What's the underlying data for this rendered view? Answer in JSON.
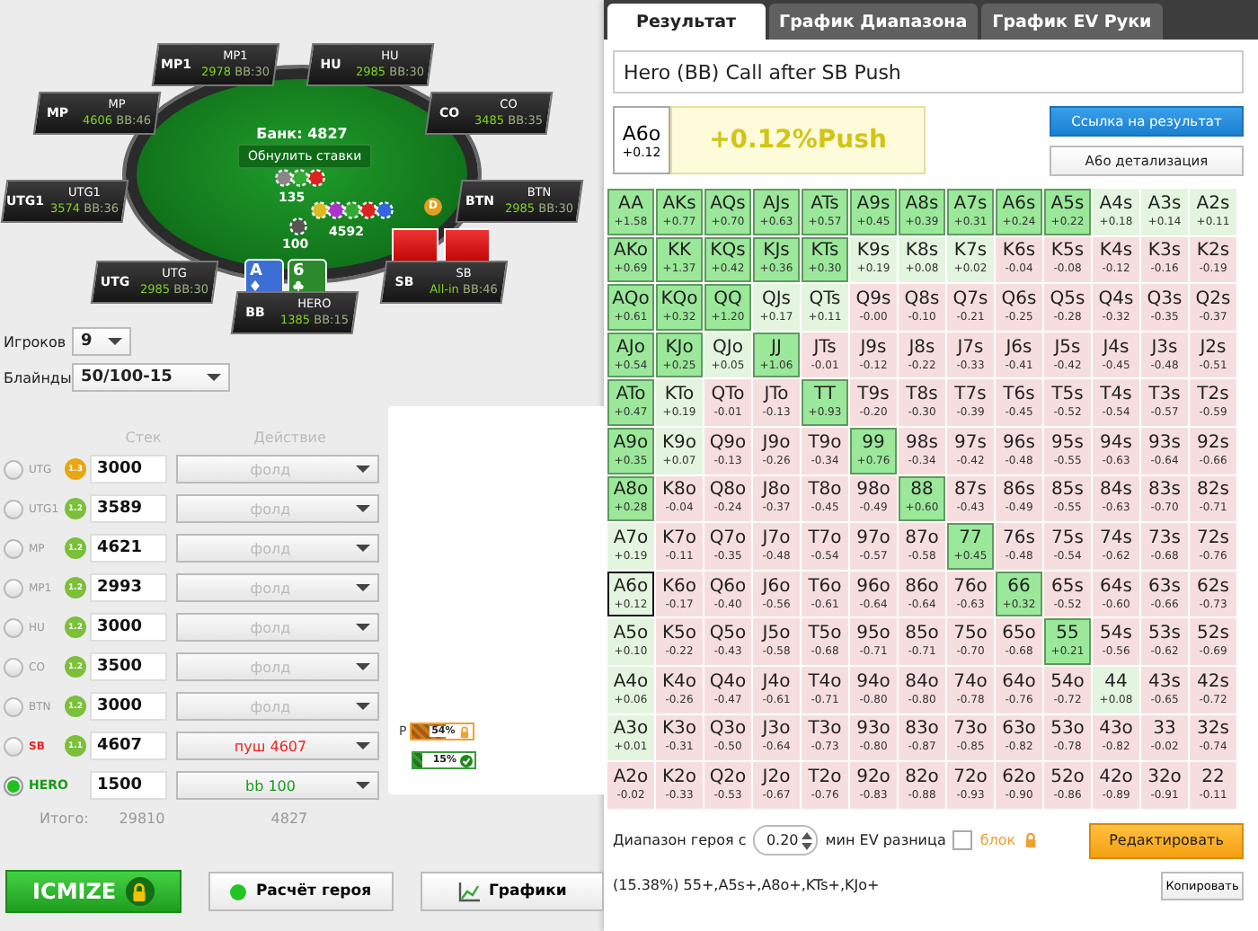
{
  "table": {
    "pot": "Банк: 4827",
    "reset_button": "Обнулить ставки",
    "dealer_button": "D",
    "seats": [
      {
        "position": "MP1",
        "name": "MP1",
        "stack": "2978",
        "bb": "BB:30"
      },
      {
        "position": "HU",
        "name": "HU",
        "stack": "2985",
        "bb": "BB:30"
      },
      {
        "position": "MP",
        "name": "MP",
        "stack": "4606",
        "bb": "BB:46"
      },
      {
        "position": "CO",
        "name": "CO",
        "stack": "3485",
        "bb": "BB:35"
      },
      {
        "position": "UTG1",
        "name": "UTG1",
        "stack": "3574",
        "bb": "BB:36"
      },
      {
        "position": "BTN",
        "name": "BTN",
        "stack": "2985",
        "bb": "BB:30"
      },
      {
        "position": "UTG",
        "name": "UTG",
        "stack": "2985",
        "bb": "BB:30"
      },
      {
        "position": "BB",
        "name": "HERO",
        "stack": "1385",
        "bb": "BB:15"
      },
      {
        "position": "SB",
        "name": "SB",
        "stack": "All-in",
        "bb": "BB:46"
      }
    ],
    "bets": [
      {
        "amount": "135"
      },
      {
        "amount": "4592"
      },
      {
        "amount": "100"
      }
    ],
    "hero_cards": [
      {
        "rank": "A",
        "kind": "diamond"
      },
      {
        "rank": "6",
        "kind": "club"
      }
    ]
  },
  "settings": {
    "players_label": "Игроков",
    "players": "9",
    "blinds_label": "Блайнды",
    "blinds": "50/100-15",
    "stack_header": "Стек",
    "action_header": "Действие"
  },
  "players": [
    {
      "position": "UTG",
      "badge": "1.3",
      "color": "#e8a614",
      "stack": "3000",
      "action": "фолд",
      "kind": "fold",
      "selected": false
    },
    {
      "position": "UTG1",
      "badge": "1.2",
      "color": "#7cbf3a",
      "stack": "3589",
      "action": "фолд",
      "kind": "fold",
      "selected": false
    },
    {
      "position": "MP",
      "badge": "1.2",
      "color": "#7cbf3a",
      "stack": "4621",
      "action": "фолд",
      "kind": "fold",
      "selected": false
    },
    {
      "position": "MP1",
      "badge": "1.2",
      "color": "#7cbf3a",
      "stack": "2993",
      "action": "фолд",
      "kind": "fold",
      "selected": false
    },
    {
      "position": "HU",
      "badge": "1.2",
      "color": "#7cbf3a",
      "stack": "3000",
      "action": "фолд",
      "kind": "fold",
      "selected": false
    },
    {
      "position": "CO",
      "badge": "1.2",
      "color": "#7cbf3a",
      "stack": "3500",
      "action": "фолд",
      "kind": "fold",
      "selected": false
    },
    {
      "position": "BTN",
      "badge": "1.2",
      "color": "#7cbf3a",
      "stack": "3000",
      "action": "фолд",
      "kind": "fold",
      "selected": false
    },
    {
      "position": "SB",
      "badge": "1.1",
      "color": "#7cbf3a",
      "stack": "4607",
      "action": "пуш 4607",
      "kind": "push",
      "selected": false
    },
    {
      "position": "HERO",
      "stack": "1500",
      "action": "bb 100",
      "kind": "call",
      "selected": true
    }
  ],
  "totals": {
    "label": "Итого:",
    "stack": "29810",
    "pot": "4827"
  },
  "ranges": [
    {
      "label": "P",
      "kind": "locked",
      "level": 0.54,
      "reading": "54%"
    },
    {
      "kind": "checked",
      "level": 0.15,
      "reading": "15%"
    }
  ],
  "buttons": [
    {
      "label": "ICMIZE",
      "kind": "primary"
    },
    {
      "label": "Расчёт героя",
      "kind": "dot"
    },
    {
      "label": "Графики",
      "kind": "chart"
    }
  ],
  "result": {
    "tabs": [
      {
        "label": "Результат",
        "selected": true
      },
      {
        "label": "График Диапазона",
        "selected": false
      },
      {
        "label": "График EV Руки",
        "selected": false
      }
    ],
    "title": "Hero (BB) Call after SB Push",
    "hand": "A6o",
    "hand_ev": "+0.12",
    "verdict": "+0.12%Push",
    "link_button": "Ссылка на результат",
    "detail_button": "A6o детализация",
    "grid": [
      [
        {
          "hand": "AA",
          "ev": "+1.58",
          "in_range": true,
          "current": false
        },
        {
          "hand": "AKs",
          "ev": "+0.77",
          "in_range": true,
          "current": false
        },
        {
          "hand": "AQs",
          "ev": "+0.70",
          "in_range": true,
          "current": false
        },
        {
          "hand": "AJs",
          "ev": "+0.63",
          "in_range": true,
          "current": false
        },
        {
          "hand": "ATs",
          "ev": "+0.57",
          "in_range": true,
          "current": false
        },
        {
          "hand": "A9s",
          "ev": "+0.45",
          "in_range": true,
          "current": false
        },
        {
          "hand": "A8s",
          "ev": "+0.39",
          "in_range": true,
          "current": false
        },
        {
          "hand": "A7s",
          "ev": "+0.31",
          "in_range": true,
          "current": false
        },
        {
          "hand": "A6s",
          "ev": "+0.24",
          "in_range": true,
          "current": false
        },
        {
          "hand": "A5s",
          "ev": "+0.22",
          "in_range": true,
          "current": false
        },
        {
          "hand": "A4s",
          "ev": "+0.18",
          "in_range": false,
          "current": false
        },
        {
          "hand": "A3s",
          "ev": "+0.14",
          "in_range": false,
          "current": false
        },
        {
          "hand": "A2s",
          "ev": "+0.11",
          "in_range": false,
          "current": false
        }
      ],
      [
        {
          "hand": "AKo",
          "ev": "+0.69",
          "in_range": true,
          "current": false
        },
        {
          "hand": "KK",
          "ev": "+1.37",
          "in_range": true,
          "current": false
        },
        {
          "hand": "KQs",
          "ev": "+0.42",
          "in_range": true,
          "current": false
        },
        {
          "hand": "KJs",
          "ev": "+0.36",
          "in_range": true,
          "current": false
        },
        {
          "hand": "KTs",
          "ev": "+0.30",
          "in_range": true,
          "current": false
        },
        {
          "hand": "K9s",
          "ev": "+0.19",
          "in_range": false,
          "current": false
        },
        {
          "hand": "K8s",
          "ev": "+0.08",
          "in_range": false,
          "current": false
        },
        {
          "hand": "K7s",
          "ev": "+0.02",
          "in_range": false,
          "current": false
        },
        {
          "hand": "K6s",
          "ev": "-0.04",
          "in_range": false,
          "current": false
        },
        {
          "hand": "K5s",
          "ev": "-0.08",
          "in_range": false,
          "current": false
        },
        {
          "hand": "K4s",
          "ev": "-0.12",
          "in_range": false,
          "current": false
        },
        {
          "hand": "K3s",
          "ev": "-0.16",
          "in_range": false,
          "current": false
        },
        {
          "hand": "K2s",
          "ev": "-0.19",
          "in_range": false,
          "current": false
        }
      ],
      [
        {
          "hand": "AQo",
          "ev": "+0.61",
          "in_range": true,
          "current": false
        },
        {
          "hand": "KQo",
          "ev": "+0.32",
          "in_range": true,
          "current": false
        },
        {
          "hand": "QQ",
          "ev": "+1.20",
          "in_range": true,
          "current": false
        },
        {
          "hand": "QJs",
          "ev": "+0.17",
          "in_range": false,
          "current": false
        },
        {
          "hand": "QTs",
          "ev": "+0.11",
          "in_range": false,
          "current": false
        },
        {
          "hand": "Q9s",
          "ev": "-0.00",
          "in_range": false,
          "current": false
        },
        {
          "hand": "Q8s",
          "ev": "-0.10",
          "in_range": false,
          "current": false
        },
        {
          "hand": "Q7s",
          "ev": "-0.21",
          "in_range": false,
          "current": false
        },
        {
          "hand": "Q6s",
          "ev": "-0.25",
          "in_range": false,
          "current": false
        },
        {
          "hand": "Q5s",
          "ev": "-0.28",
          "in_range": false,
          "current": false
        },
        {
          "hand": "Q4s",
          "ev": "-0.32",
          "in_range": false,
          "current": false
        },
        {
          "hand": "Q3s",
          "ev": "-0.35",
          "in_range": false,
          "current": false
        },
        {
          "hand": "Q2s",
          "ev": "-0.37",
          "in_range": false,
          "current": false
        }
      ],
      [
        {
          "hand": "AJo",
          "ev": "+0.54",
          "in_range": true,
          "current": false
        },
        {
          "hand": "KJo",
          "ev": "+0.25",
          "in_range": true,
          "current": false
        },
        {
          "hand": "QJo",
          "ev": "+0.05",
          "in_range": false,
          "current": false
        },
        {
          "hand": "JJ",
          "ev": "+1.06",
          "in_range": true,
          "current": false
        },
        {
          "hand": "JTs",
          "ev": "-0.01",
          "in_range": false,
          "current": false
        },
        {
          "hand": "J9s",
          "ev": "-0.12",
          "in_range": false,
          "current": false
        },
        {
          "hand": "J8s",
          "ev": "-0.22",
          "in_range": false,
          "current": false
        },
        {
          "hand": "J7s",
          "ev": "-0.33",
          "in_range": false,
          "current": false
        },
        {
          "hand": "J6s",
          "ev": "-0.41",
          "in_range": false,
          "current": false
        },
        {
          "hand": "J5s",
          "ev": "-0.42",
          "in_range": false,
          "current": false
        },
        {
          "hand": "J4s",
          "ev": "-0.45",
          "in_range": false,
          "current": false
        },
        {
          "hand": "J3s",
          "ev": "-0.48",
          "in_range": false,
          "current": false
        },
        {
          "hand": "J2s",
          "ev": "-0.51",
          "in_range": false,
          "current": false
        }
      ],
      [
        {
          "hand": "ATo",
          "ev": "+0.47",
          "in_range": true,
          "current": false
        },
        {
          "hand": "KTo",
          "ev": "+0.19",
          "in_range": false,
          "current": false
        },
        {
          "hand": "QTo",
          "ev": "-0.01",
          "in_range": false,
          "current": false
        },
        {
          "hand": "JTo",
          "ev": "-0.13",
          "in_range": false,
          "current": false
        },
        {
          "hand": "TT",
          "ev": "+0.93",
          "in_range": true,
          "current": false
        },
        {
          "hand": "T9s",
          "ev": "-0.20",
          "in_range": false,
          "current": false
        },
        {
          "hand": "T8s",
          "ev": "-0.30",
          "in_range": false,
          "current": false
        },
        {
          "hand": "T7s",
          "ev": "-0.39",
          "in_range": false,
          "current": false
        },
        {
          "hand": "T6s",
          "ev": "-0.45",
          "in_range": false,
          "current": false
        },
        {
          "hand": "T5s",
          "ev": "-0.52",
          "in_range": false,
          "current": false
        },
        {
          "hand": "T4s",
          "ev": "-0.54",
          "in_range": false,
          "current": false
        },
        {
          "hand": "T3s",
          "ev": "-0.57",
          "in_range": false,
          "current": false
        },
        {
          "hand": "T2s",
          "ev": "-0.59",
          "in_range": false,
          "current": false
        }
      ],
      [
        {
          "hand": "A9o",
          "ev": "+0.35",
          "in_range": true,
          "current": false
        },
        {
          "hand": "K9o",
          "ev": "+0.07",
          "in_range": false,
          "current": false
        },
        {
          "hand": "Q9o",
          "ev": "-0.13",
          "in_range": false,
          "current": false
        },
        {
          "hand": "J9o",
          "ev": "-0.26",
          "in_range": false,
          "current": false
        },
        {
          "hand": "T9o",
          "ev": "-0.34",
          "in_range": false,
          "current": false
        },
        {
          "hand": "99",
          "ev": "+0.76",
          "in_range": true,
          "current": false
        },
        {
          "hand": "98s",
          "ev": "-0.34",
          "in_range": false,
          "current": false
        },
        {
          "hand": "97s",
          "ev": "-0.42",
          "in_range": false,
          "current": false
        },
        {
          "hand": "96s",
          "ev": "-0.48",
          "in_range": false,
          "current": false
        },
        {
          "hand": "95s",
          "ev": "-0.55",
          "in_range": false,
          "current": false
        },
        {
          "hand": "94s",
          "ev": "-0.63",
          "in_range": false,
          "current": false
        },
        {
          "hand": "93s",
          "ev": "-0.64",
          "in_range": false,
          "current": false
        },
        {
          "hand": "92s",
          "ev": "-0.66",
          "in_range": false,
          "current": false
        }
      ],
      [
        {
          "hand": "A8o",
          "ev": "+0.28",
          "in_range": true,
          "current": false
        },
        {
          "hand": "K8o",
          "ev": "-0.04",
          "in_range": false,
          "current": false
        },
        {
          "hand": "Q8o",
          "ev": "-0.24",
          "in_range": false,
          "current": false
        },
        {
          "hand": "J8o",
          "ev": "-0.37",
          "in_range": false,
          "current": false
        },
        {
          "hand": "T8o",
          "ev": "-0.45",
          "in_range": false,
          "current": false
        },
        {
          "hand": "98o",
          "ev": "-0.49",
          "in_range": false,
          "current": false
        },
        {
          "hand": "88",
          "ev": "+0.60",
          "in_range": true,
          "current": false
        },
        {
          "hand": "87s",
          "ev": "-0.43",
          "in_range": false,
          "current": false
        },
        {
          "hand": "86s",
          "ev": "-0.49",
          "in_range": false,
          "current": false
        },
        {
          "hand": "85s",
          "ev": "-0.55",
          "in_range": false,
          "current": false
        },
        {
          "hand": "84s",
          "ev": "-0.63",
          "in_range": false,
          "current": false
        },
        {
          "hand": "83s",
          "ev": "-0.70",
          "in_range": false,
          "current": false
        },
        {
          "hand": "82s",
          "ev": "-0.71",
          "in_range": false,
          "current": false
        }
      ],
      [
        {
          "hand": "A7o",
          "ev": "+0.19",
          "in_range": false,
          "current": false
        },
        {
          "hand": "K7o",
          "ev": "-0.11",
          "in_range": false,
          "current": false
        },
        {
          "hand": "Q7o",
          "ev": "-0.35",
          "in_range": false,
          "current": false
        },
        {
          "hand": "J7o",
          "ev": "-0.48",
          "in_range": false,
          "current": false
        },
        {
          "hand": "T7o",
          "ev": "-0.54",
          "in_range": false,
          "current": false
        },
        {
          "hand": "97o",
          "ev": "-0.57",
          "in_range": false,
          "current": false
        },
        {
          "hand": "87o",
          "ev": "-0.58",
          "in_range": false,
          "current": false
        },
        {
          "hand": "77",
          "ev": "+0.45",
          "in_range": true,
          "current": false
        },
        {
          "hand": "76s",
          "ev": "-0.48",
          "in_range": false,
          "current": false
        },
        {
          "hand": "75s",
          "ev": "-0.54",
          "in_range": false,
          "current": false
        },
        {
          "hand": "74s",
          "ev": "-0.62",
          "in_range": false,
          "current": false
        },
        {
          "hand": "73s",
          "ev": "-0.68",
          "in_range": false,
          "current": false
        },
        {
          "hand": "72s",
          "ev": "-0.76",
          "in_range": false,
          "current": false
        }
      ],
      [
        {
          "hand": "A6o",
          "ev": "+0.12",
          "in_range": false,
          "current": true
        },
        {
          "hand": "K6o",
          "ev": "-0.17",
          "in_range": false,
          "current": false
        },
        {
          "hand": "Q6o",
          "ev": "-0.40",
          "in_range": false,
          "current": false
        },
        {
          "hand": "J6o",
          "ev": "-0.56",
          "in_range": false,
          "current": false
        },
        {
          "hand": "T6o",
          "ev": "-0.61",
          "in_range": false,
          "current": false
        },
        {
          "hand": "96o",
          "ev": "-0.64",
          "in_range": false,
          "current": false
        },
        {
          "hand": "86o",
          "ev": "-0.64",
          "in_range": false,
          "current": false
        },
        {
          "hand": "76o",
          "ev": "-0.63",
          "in_range": false,
          "current": false
        },
        {
          "hand": "66",
          "ev": "+0.32",
          "in_range": true,
          "current": false
        },
        {
          "hand": "65s",
          "ev": "-0.52",
          "in_range": false,
          "current": false
        },
        {
          "hand": "64s",
          "ev": "-0.60",
          "in_range": false,
          "current": false
        },
        {
          "hand": "63s",
          "ev": "-0.66",
          "in_range": false,
          "current": false
        },
        {
          "hand": "62s",
          "ev": "-0.73",
          "in_range": false,
          "current": false
        }
      ],
      [
        {
          "hand": "A5o",
          "ev": "+0.10",
          "in_range": false,
          "current": false
        },
        {
          "hand": "K5o",
          "ev": "-0.22",
          "in_range": false,
          "current": false
        },
        {
          "hand": "Q5o",
          "ev": "-0.43",
          "in_range": false,
          "current": false
        },
        {
          "hand": "J5o",
          "ev": "-0.58",
          "in_range": false,
          "current": false
        },
        {
          "hand": "T5o",
          "ev": "-0.68",
          "in_range": false,
          "current": false
        },
        {
          "hand": "95o",
          "ev": "-0.71",
          "in_range": false,
          "current": false
        },
        {
          "hand": "85o",
          "ev": "-0.71",
          "in_range": false,
          "current": false
        },
        {
          "hand": "75o",
          "ev": "-0.70",
          "in_range": false,
          "current": false
        },
        {
          "hand": "65o",
          "ev": "-0.68",
          "in_range": false,
          "current": false
        },
        {
          "hand": "55",
          "ev": "+0.21",
          "in_range": true,
          "current": false
        },
        {
          "hand": "54s",
          "ev": "-0.56",
          "in_range": false,
          "current": false
        },
        {
          "hand": "53s",
          "ev": "-0.62",
          "in_range": false,
          "current": false
        },
        {
          "hand": "52s",
          "ev": "-0.69",
          "in_range": false,
          "current": false
        }
      ],
      [
        {
          "hand": "A4o",
          "ev": "+0.06",
          "in_range": false,
          "current": false
        },
        {
          "hand": "K4o",
          "ev": "-0.26",
          "in_range": false,
          "current": false
        },
        {
          "hand": "Q4o",
          "ev": "-0.47",
          "in_range": false,
          "current": false
        },
        {
          "hand": "J4o",
          "ev": "-0.61",
          "in_range": false,
          "current": false
        },
        {
          "hand": "T4o",
          "ev": "-0.71",
          "in_range": false,
          "current": false
        },
        {
          "hand": "94o",
          "ev": "-0.80",
          "in_range": false,
          "current": false
        },
        {
          "hand": "84o",
          "ev": "-0.80",
          "in_range": false,
          "current": false
        },
        {
          "hand": "74o",
          "ev": "-0.78",
          "in_range": false,
          "current": false
        },
        {
          "hand": "64o",
          "ev": "-0.76",
          "in_range": false,
          "current": false
        },
        {
          "hand": "54o",
          "ev": "-0.72",
          "in_range": false,
          "current": false
        },
        {
          "hand": "44",
          "ev": "+0.08",
          "in_range": false,
          "current": false
        },
        {
          "hand": "43s",
          "ev": "-0.65",
          "in_range": false,
          "current": false
        },
        {
          "hand": "42s",
          "ev": "-0.72",
          "in_range": false,
          "current": false
        }
      ],
      [
        {
          "hand": "A3o",
          "ev": "+0.01",
          "in_range": false,
          "current": false
        },
        {
          "hand": "K3o",
          "ev": "-0.31",
          "in_range": false,
          "current": false
        },
        {
          "hand": "Q3o",
          "ev": "-0.50",
          "in_range": false,
          "current": false
        },
        {
          "hand": "J3o",
          "ev": "-0.64",
          "in_range": false,
          "current": false
        },
        {
          "hand": "T3o",
          "ev": "-0.73",
          "in_range": false,
          "current": false
        },
        {
          "hand": "93o",
          "ev": "-0.80",
          "in_range": false,
          "current": false
        },
        {
          "hand": "83o",
          "ev": "-0.87",
          "in_range": false,
          "current": false
        },
        {
          "hand": "73o",
          "ev": "-0.85",
          "in_range": false,
          "current": false
        },
        {
          "hand": "63o",
          "ev": "-0.82",
          "in_range": false,
          "current": false
        },
        {
          "hand": "53o",
          "ev": "-0.78",
          "in_range": false,
          "current": false
        },
        {
          "hand": "43o",
          "ev": "-0.82",
          "in_range": false,
          "current": false
        },
        {
          "hand": "33",
          "ev": "-0.02",
          "in_range": false,
          "current": false
        },
        {
          "hand": "32s",
          "ev": "-0.74",
          "in_range": false,
          "current": false
        }
      ],
      [
        {
          "hand": "A2o",
          "ev": "-0.02",
          "in_range": false,
          "current": false
        },
        {
          "hand": "K2o",
          "ev": "-0.33",
          "in_range": false,
          "current": false
        },
        {
          "hand": "Q2o",
          "ev": "-0.53",
          "in_range": false,
          "current": false
        },
        {
          "hand": "J2o",
          "ev": "-0.67",
          "in_range": false,
          "current": false
        },
        {
          "hand": "T2o",
          "ev": "-0.76",
          "in_range": false,
          "current": false
        },
        {
          "hand": "92o",
          "ev": "-0.83",
          "in_range": false,
          "current": false
        },
        {
          "hand": "82o",
          "ev": "-0.88",
          "in_range": false,
          "current": false
        },
        {
          "hand": "72o",
          "ev": "-0.93",
          "in_range": false,
          "current": false
        },
        {
          "hand": "62o",
          "ev": "-0.90",
          "in_range": false,
          "current": false
        },
        {
          "hand": "52o",
          "ev": "-0.86",
          "in_range": false,
          "current": false
        },
        {
          "hand": "42o",
          "ev": "-0.89",
          "in_range": false,
          "current": false
        },
        {
          "hand": "32o",
          "ev": "-0.91",
          "in_range": false,
          "current": false
        },
        {
          "hand": "22",
          "ev": "-0.11",
          "in_range": false,
          "current": false
        }
      ]
    ],
    "range_label": "Диапазон героя с",
    "range_min": "0.20",
    "ev_label": "мин EV разница",
    "block_checked": false,
    "block_label": "блок",
    "edit_button": "Редактировать",
    "range_text": "(15.38%) 55+,A5s+,A8o+,KTs+,KJo+",
    "copy_button": "Копировать"
  }
}
